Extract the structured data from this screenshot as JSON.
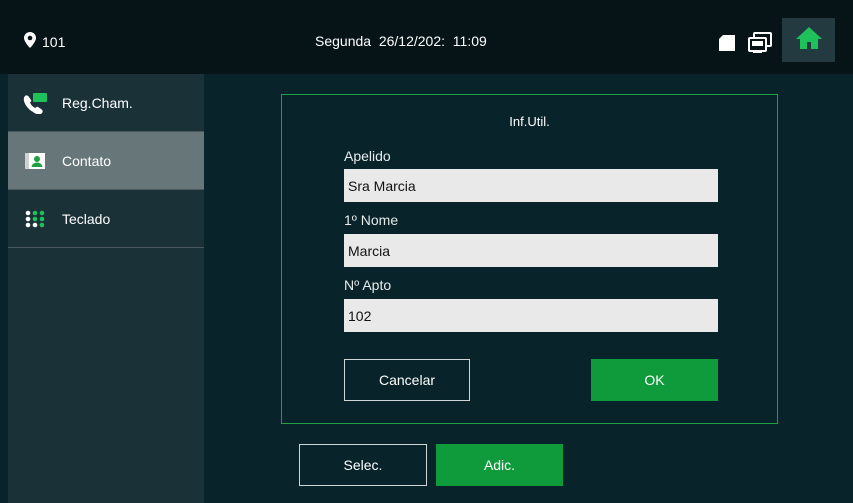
{
  "header": {
    "location": "101",
    "datetime": "Segunda  26/12/202:  11:09",
    "icons": [
      "location-pin-icon",
      "sd-card-icon",
      "monitor-icon",
      "home-icon"
    ]
  },
  "sidebar": {
    "items": [
      {
        "label": "Reg.Cham.",
        "icon": "call-log-icon",
        "active": false
      },
      {
        "label": "Contato",
        "icon": "contact-card-icon",
        "active": true
      },
      {
        "label": "Teclado",
        "icon": "keypad-icon",
        "active": false
      }
    ]
  },
  "dialog": {
    "title": "Inf.Util.",
    "fields": [
      {
        "label": "Apelido",
        "value": "Sra Marcia"
      },
      {
        "label": "1º Nome",
        "value": "Marcia"
      },
      {
        "label": "Nº Apto",
        "value": "102"
      }
    ],
    "cancel_label": "Cancelar",
    "ok_label": "OK"
  },
  "footer": {
    "select_label": "Selec.",
    "add_label": "Adic."
  },
  "colors": {
    "accent_green": "#0f9a3b",
    "background": "#08232a",
    "sidebar": "#1a3138",
    "sidebar_active": "#677779",
    "topbar": "#061418"
  }
}
